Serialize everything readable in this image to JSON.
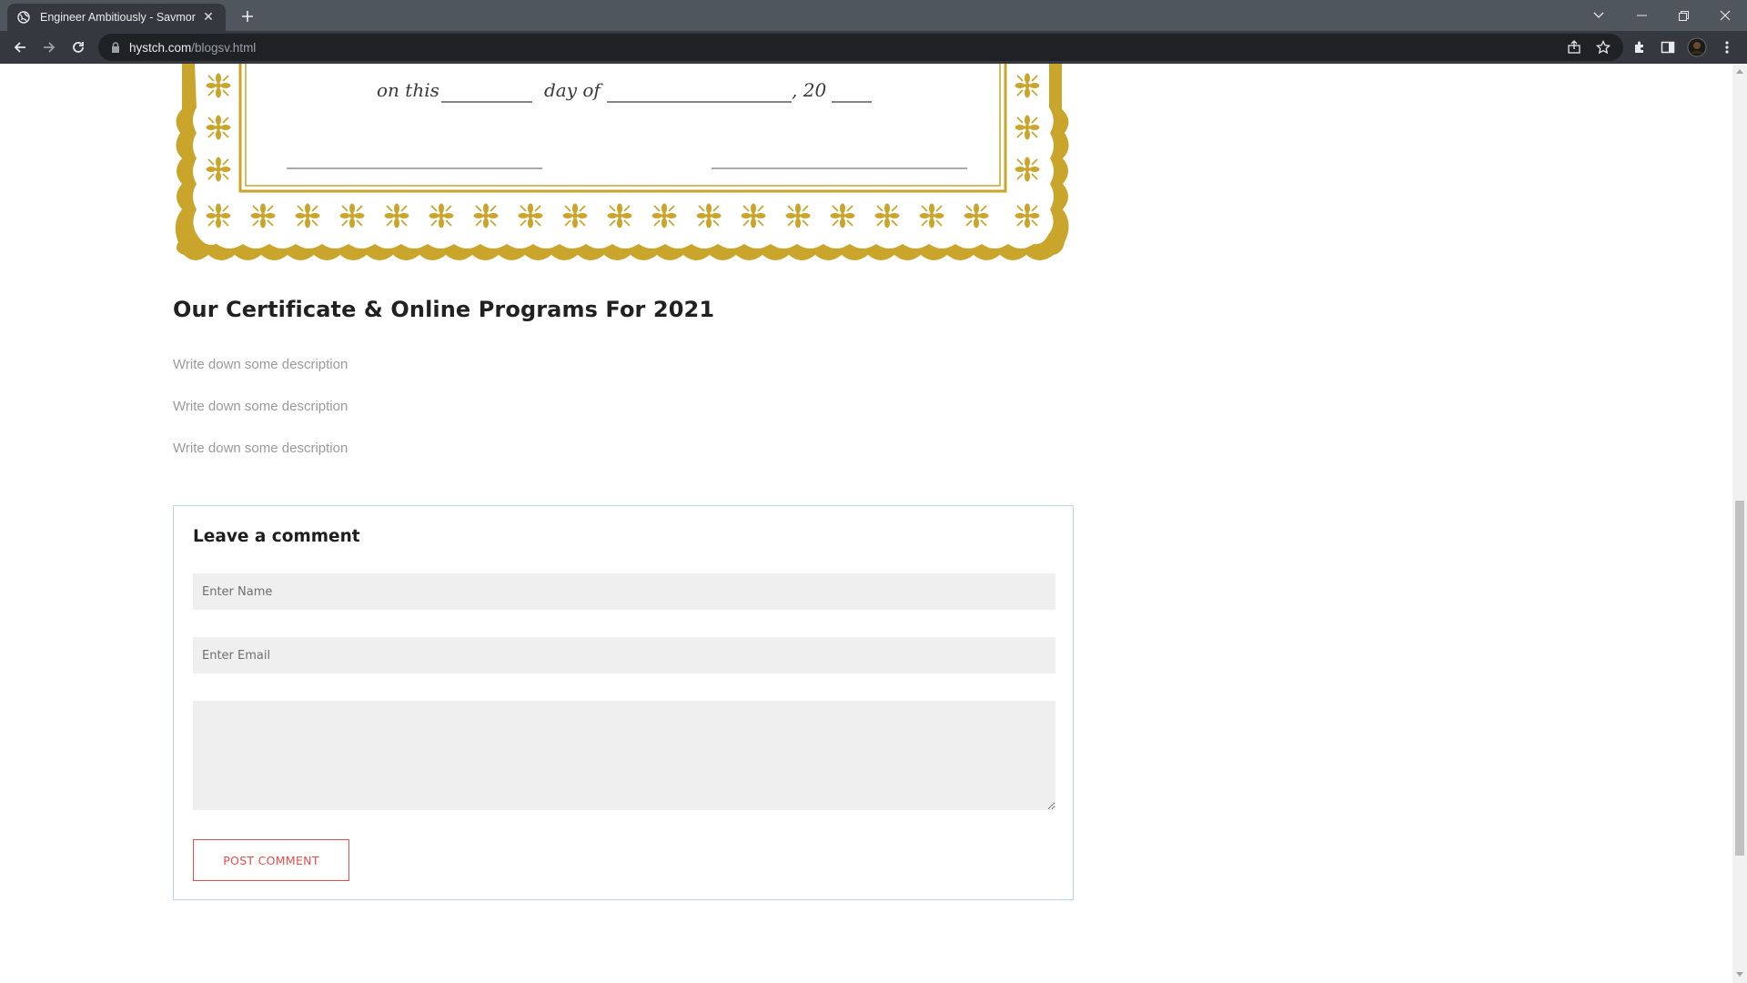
{
  "browser": {
    "tab_title": "Engineer Ambitiously - Savmor",
    "url_host": "hystch.com",
    "url_path": "/blogsv.html",
    "icons": [
      "globe-icon",
      "close-icon",
      "plus-icon",
      "chevron-down-icon",
      "minimize-icon",
      "restore-icon",
      "close-icon",
      "back-icon",
      "forward-icon",
      "reload-icon",
      "lock-icon",
      "share-icon",
      "star-icon",
      "extensions-icon",
      "side-panel-icon",
      "avatar",
      "more-icon"
    ]
  },
  "certificate": {
    "line_on_this": "on this",
    "line_day_of": "day of",
    "line_year_prefix": ", 20",
    "border_color": "#c9a52b"
  },
  "post": {
    "heading": "Our Certificate & Online Programs For 2021",
    "descriptions": [
      "Write down some description",
      "Write down some description",
      "Write down some description"
    ]
  },
  "comment_form": {
    "title": "Leave a comment",
    "name_placeholder": "Enter Name",
    "email_placeholder": "Enter Email",
    "message_placeholder": "",
    "submit_label": "POST COMMENT",
    "accent_color": "#e84b4b",
    "border_color": "#b9d6dc"
  }
}
